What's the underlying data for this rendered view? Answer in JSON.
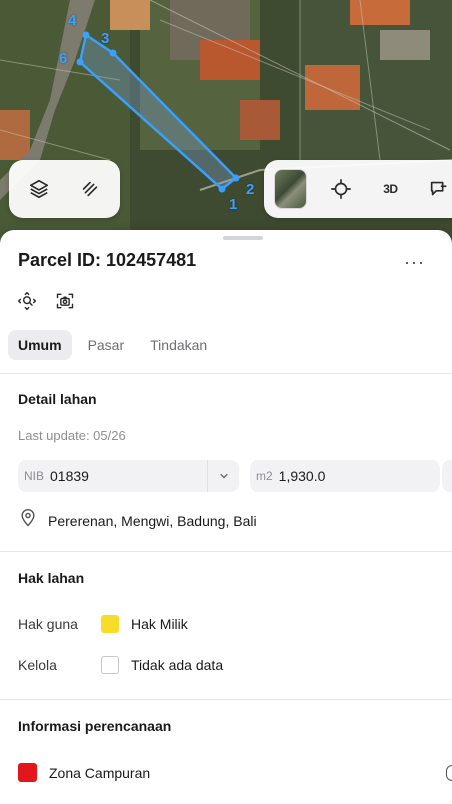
{
  "map": {
    "vertex_labels": [
      "4",
      "3",
      "6",
      "2",
      "1"
    ],
    "polygon_color": "#3aa0ff",
    "left_controls": [
      "layers-icon",
      "draw-icon"
    ],
    "right_controls": [
      "satellite-thumbnail",
      "locate-icon",
      "3d-toggle",
      "share-icon"
    ],
    "label_3d": "3D"
  },
  "sheet": {
    "title": "Parcel ID: 102457481",
    "more_label": "···",
    "tabs": [
      "Umum",
      "Pasar",
      "Tindakan"
    ],
    "active_tab": "Umum"
  },
  "detail": {
    "title": "Detail lahan",
    "last_update": "Last update: 05/26",
    "nib_prefix": "NIB",
    "nib_value": "01839",
    "area_prefix": "m2",
    "area_value": "1,930.0",
    "location": "Pererenan, Mengwi, Badung, Bali"
  },
  "rights": {
    "title": "Hak lahan",
    "rows": [
      {
        "key": "Hak guna",
        "value": "Hak Milik",
        "color": "#f7dc2a"
      },
      {
        "key": "Kelola",
        "value": "Tidak ada data",
        "color": "#ffffff"
      }
    ]
  },
  "planning": {
    "title": "Informasi perencanaan",
    "zone": "Zona Campuran",
    "zone_color": "#e3161c"
  }
}
